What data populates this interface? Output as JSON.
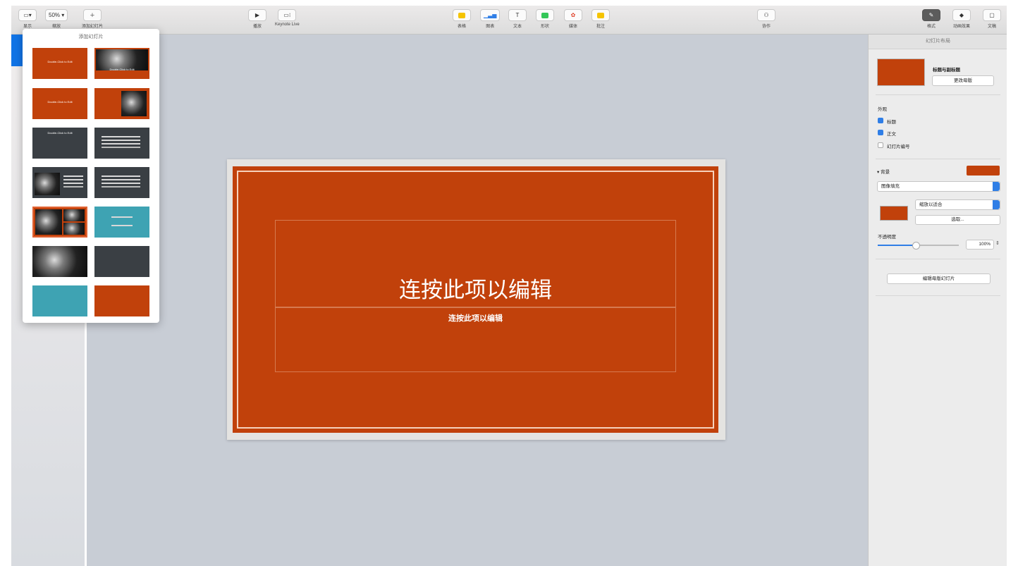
{
  "toolbar": {
    "view_label": "显示",
    "zoom_value": "50% ▾",
    "zoom_label": "缩放",
    "add_slide_label": "添加幻灯片",
    "play_label": "播放",
    "keynote_live_label": "Keynote Live",
    "table_label": "表格",
    "chart_label": "图表",
    "text_label": "文本",
    "shape_label": "形状",
    "media_label": "媒体",
    "comment_label": "批注",
    "collaborate_label": "协作",
    "format_label": "格式",
    "animate_label": "动画效果",
    "document_label": "文稿"
  },
  "popup": {
    "title": "添加幻灯片",
    "thumb_title_text": "Double-Click to Edit"
  },
  "slide": {
    "title": "连按此项以编辑",
    "subtitle": "连按此项以编辑"
  },
  "inspector": {
    "header": "幻灯片布局",
    "layout_name": "标题与副标题",
    "change_master": "更改母版",
    "appearance_label": "外观",
    "title_check": "标题",
    "body_check": "正文",
    "slide_number_check": "幻灯片编号",
    "background_label": "背景",
    "fill_type": "图像填充",
    "scale_type": "缩放以适合",
    "choose_button": "选取...",
    "opacity_label": "不透明度",
    "opacity_value": "100%",
    "edit_master_button": "编辑母版幻灯片",
    "title_checked": true,
    "body_checked": true,
    "slide_number_checked": false
  },
  "colors": {
    "slide_orange": "#c1410b",
    "teal": "#3ea3b3",
    "dark_slate": "#3a3f44",
    "accent_blue": "#2f7ee6"
  },
  "thumbs": [
    {
      "style": "orange-title"
    },
    {
      "style": "photo-title"
    },
    {
      "style": "orange-title-only"
    },
    {
      "style": "orange-photo-right"
    },
    {
      "style": "dark-title"
    },
    {
      "style": "dark-bullets"
    },
    {
      "style": "dark-photo-bullets"
    },
    {
      "style": "dark-bullets-2"
    },
    {
      "style": "photo-grid"
    },
    {
      "style": "teal-quote"
    },
    {
      "style": "photo-full"
    },
    {
      "style": "dark-blank"
    },
    {
      "style": "teal-blank"
    },
    {
      "style": "orange-blank"
    }
  ]
}
